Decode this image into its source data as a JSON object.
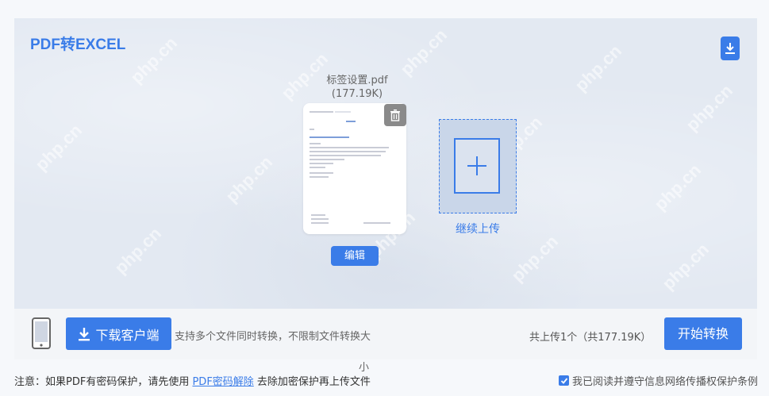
{
  "title": "PDF转EXCEL",
  "watermark": "php.cn",
  "file": {
    "name": "标签设置.pdf",
    "size": "(177.19K)",
    "edit_label": "编辑"
  },
  "add_more": {
    "label": "继续上传"
  },
  "bottom": {
    "client_button": "下载客户端",
    "support_text": "支持多个文件同时转换，不限制文件转换大",
    "support_tail": "小",
    "uploaded_text": "共上传1个（共177.19K）",
    "start_button": "开始转换"
  },
  "notice": {
    "prefix": "注意：如果PDF有密码保护，请先使用 ",
    "link": "PDF密码解除",
    "suffix": " 去除加密保护再上传文件"
  },
  "agreement": {
    "checked": true,
    "text": "我已阅读并遵守信息网络传播权保护条例"
  },
  "colors": {
    "accent": "#3a7ce8",
    "panel": "#e3e9f2"
  },
  "icons": [
    "download-icon",
    "trash-icon",
    "plus-icon",
    "phone-icon",
    "checkbox-checked-icon"
  ]
}
